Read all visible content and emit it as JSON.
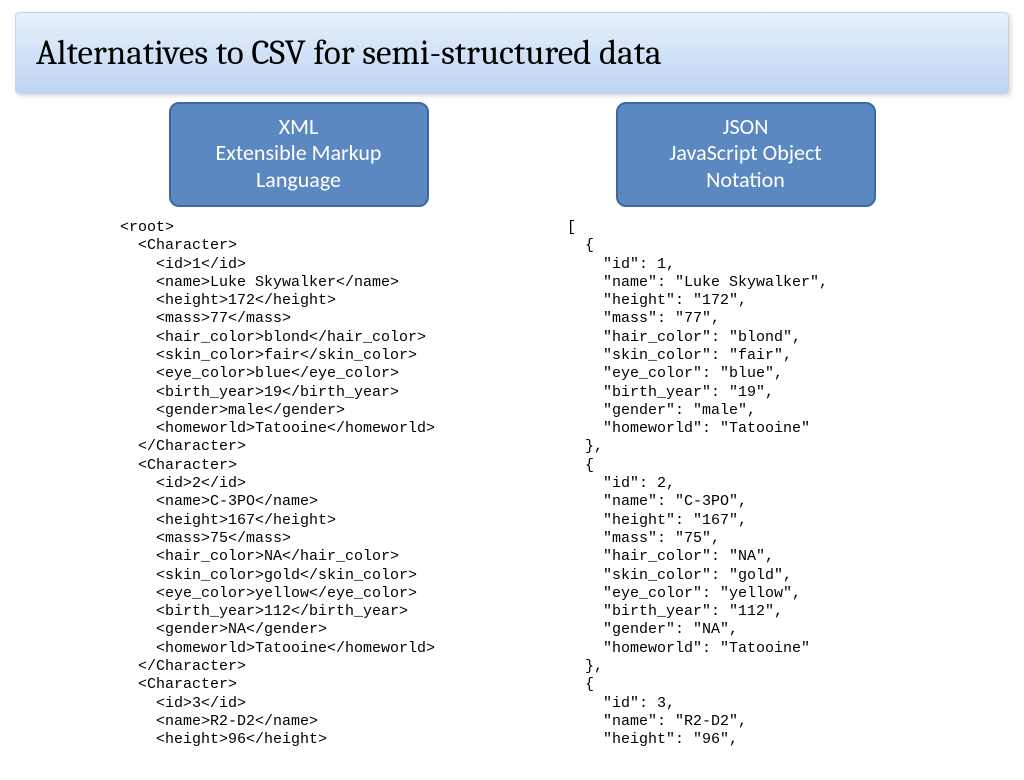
{
  "title": "Alternatives to CSV for semi-structured data",
  "left": {
    "badge_line1": "XML",
    "badge_line2": "Extensible Markup Language",
    "code": "<root>\n  <Character>\n    <id>1</id>\n    <name>Luke Skywalker</name>\n    <height>172</height>\n    <mass>77</mass>\n    <hair_color>blond</hair_color>\n    <skin_color>fair</skin_color>\n    <eye_color>blue</eye_color>\n    <birth_year>19</birth_year>\n    <gender>male</gender>\n    <homeworld>Tatooine</homeworld>\n  </Character>\n  <Character>\n    <id>2</id>\n    <name>C-3PO</name>\n    <height>167</height>\n    <mass>75</mass>\n    <hair_color>NA</hair_color>\n    <skin_color>gold</skin_color>\n    <eye_color>yellow</eye_color>\n    <birth_year>112</birth_year>\n    <gender>NA</gender>\n    <homeworld>Tatooine</homeworld>\n  </Character>\n  <Character>\n    <id>3</id>\n    <name>R2-D2</name>\n    <height>96</height>"
  },
  "right": {
    "badge_line1": "JSON",
    "badge_line2": "JavaScript Object Notation",
    "code": "[\n  {\n    \"id\": 1,\n    \"name\": \"Luke Skywalker\",\n    \"height\": \"172\",\n    \"mass\": \"77\",\n    \"hair_color\": \"blond\",\n    \"skin_color\": \"fair\",\n    \"eye_color\": \"blue\",\n    \"birth_year\": \"19\",\n    \"gender\": \"male\",\n    \"homeworld\": \"Tatooine\"\n  },\n  {\n    \"id\": 2,\n    \"name\": \"C-3PO\",\n    \"height\": \"167\",\n    \"mass\": \"75\",\n    \"hair_color\": \"NA\",\n    \"skin_color\": \"gold\",\n    \"eye_color\": \"yellow\",\n    \"birth_year\": \"112\",\n    \"gender\": \"NA\",\n    \"homeworld\": \"Tatooine\"\n  },\n  {\n    \"id\": 3,\n    \"name\": \"R2-D2\",\n    \"height\": \"96\","
  }
}
